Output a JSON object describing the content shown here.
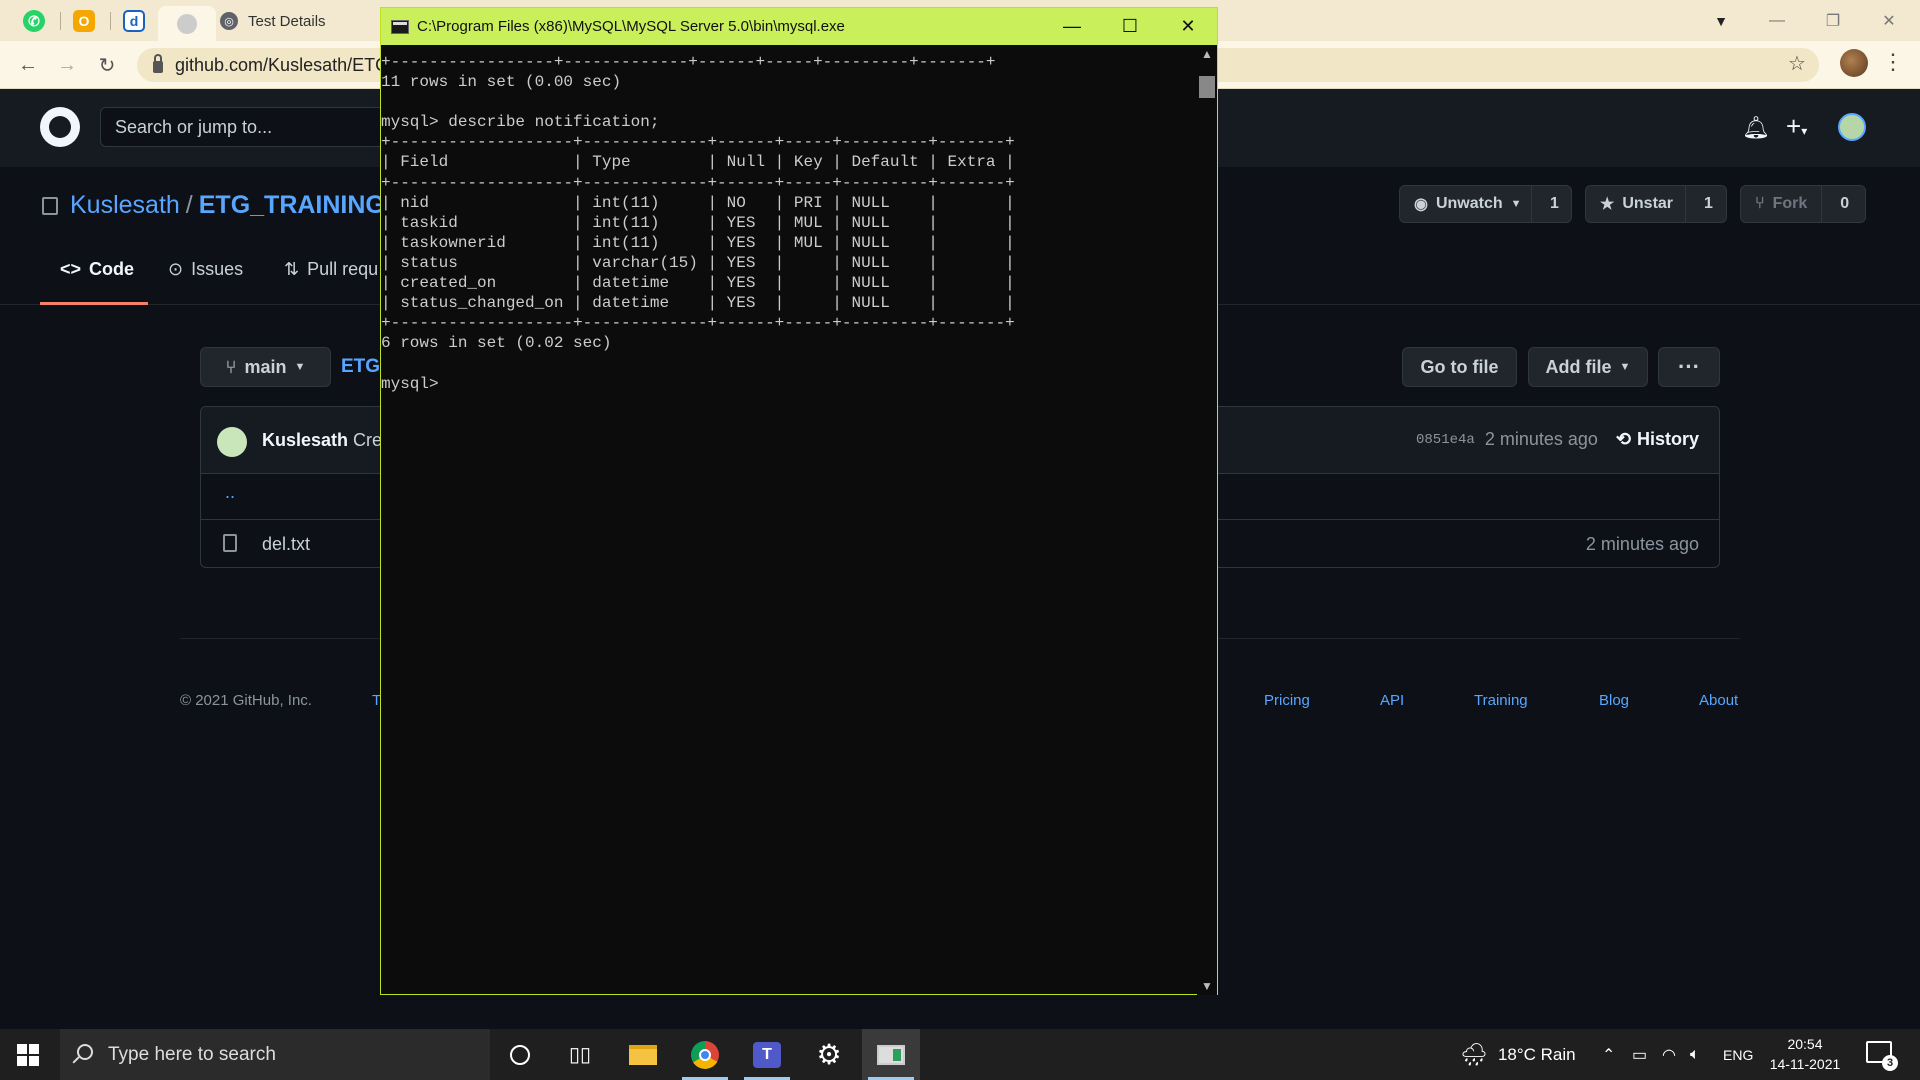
{
  "browser": {
    "active_tab_title": "Test Details",
    "url": "github.com/Kuslesath/ETG"
  },
  "github": {
    "search_placeholder": "Search or jump to...",
    "owner": "Kuslesath",
    "repo": "ETG_TRAINING_C",
    "watch_label": "Unwatch",
    "watch_count": "1",
    "star_label": "Unstar",
    "star_count": "1",
    "fork_label": "Fork",
    "fork_count": "0",
    "tabs": [
      {
        "label": "Code"
      },
      {
        "label": "Issues"
      },
      {
        "label": "Pull requ"
      }
    ],
    "branch": "main",
    "path_link": "ETG",
    "go_to_file": "Go to file",
    "add_file": "Add file",
    "commit_author": "Kuslesath",
    "commit_message": "Creat",
    "commit_sha": "0851e4a",
    "commit_age": "2 minutes ago",
    "history_label": "History",
    "up_dir": "..",
    "file_name": "del.txt",
    "file_age": "2 minutes ago",
    "footer_copyright": "© 2021 GitHub, Inc.",
    "footer_links": [
      "T",
      "Pricing",
      "API",
      "Training",
      "Blog",
      "About"
    ]
  },
  "console": {
    "title": "C:\\Program Files (x86)\\MySQL\\MySQL Server 5.0\\bin\\mysql.exe",
    "lines": [
      "+-----------------+-------------+------+-----+---------+-------+",
      "11 rows in set (0.00 sec)",
      "",
      "mysql> describe notification;",
      "+-------------------+-------------+------+-----+---------+-------+",
      "| Field             | Type        | Null | Key | Default | Extra |",
      "+-------------------+-------------+------+-----+---------+-------+",
      "| nid               | int(11)     | NO   | PRI | NULL    |       |",
      "| taskid            | int(11)     | YES  | MUL | NULL    |       |",
      "| taskownerid       | int(11)     | YES  | MUL | NULL    |       |",
      "| status            | varchar(15) | YES  |     | NULL    |       |",
      "| created_on        | datetime    | YES  |     | NULL    |       |",
      "| status_changed_on | datetime    | YES  |     | NULL    |       |",
      "+-------------------+-------------+------+-----+---------+-------+",
      "6 rows in set (0.02 sec)",
      "",
      "mysql> "
    ]
  },
  "taskbar": {
    "search_placeholder": "Type here to search",
    "weather": "18°C  Rain",
    "language": "ENG",
    "time": "20:54",
    "date": "14-11-2021",
    "notification_count": "3"
  },
  "colors": {
    "console_title_bg": "#c9f05a",
    "github_bg": "#0d1117",
    "link": "#58a6ff"
  }
}
